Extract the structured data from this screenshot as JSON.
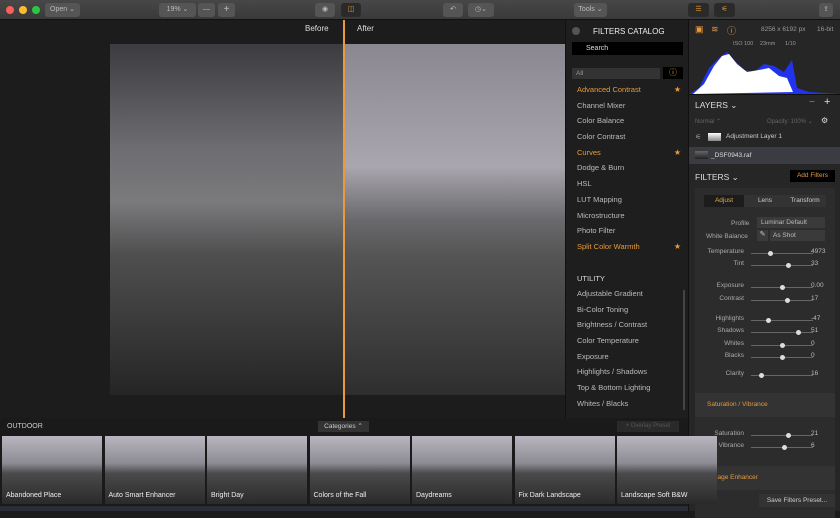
{
  "toolbar": {
    "open": "Open ⌄",
    "zoom": "19%  ⌄",
    "zoom_out": "—",
    "zoom_in": "+",
    "tools": "Tools ⌄"
  },
  "viewer": {
    "before": "Before",
    "after": "After"
  },
  "catalog": {
    "title": "FILTERS CATALOG",
    "search_placeholder": "Search",
    "filter": "All",
    "items": [
      {
        "label": "Advanced Contrast",
        "fav": true
      },
      {
        "label": "Channel Mixer"
      },
      {
        "label": "Color Balance"
      },
      {
        "label": "Color Contrast"
      },
      {
        "label": "Curves",
        "fav": true
      },
      {
        "label": "Dodge & Burn"
      },
      {
        "label": "HSL"
      },
      {
        "label": "LUT Mapping"
      },
      {
        "label": "Microstructure"
      },
      {
        "label": "Photo Filter"
      },
      {
        "label": "Split Color Warmth",
        "fav": true
      }
    ],
    "utility_header": "UTILITY",
    "utility": [
      "Adjustable Gradient",
      "Bi-Color Toning",
      "Brightness / Contrast",
      "Color Temperature",
      "Exposure",
      "Highlights / Shadows",
      "Top & Bottom Lighting",
      "Whites / Blacks"
    ]
  },
  "info": {
    "dimensions": "8256 x 6192 px",
    "bitdepth": "16-bit",
    "iso": "ISO 100",
    "focal": "23mm",
    "shutter": "1/10"
  },
  "layers": {
    "title": "LAYERS ⌄",
    "blend": "Normal ⌃",
    "opacity": "Opacity: 100% ⌄",
    "items": [
      "Adjustment Layer 1",
      "_DSF0943.raf"
    ]
  },
  "filters": {
    "title": "FILTERS ⌄",
    "add": "Add Filters",
    "tabs": [
      "Adjust",
      "Lens",
      "Transform"
    ],
    "profile_label": "Profile",
    "profile": "Luminar Default",
    "wb_label": "White Balance",
    "wb": "As Shot",
    "sliders": [
      {
        "label": "Temperature",
        "value": "4973",
        "pos": 0.3
      },
      {
        "label": "Tint",
        "value": "33",
        "pos": 0.6
      },
      {
        "label": "Exposure",
        "value": "0.00",
        "pos": 0.5
      },
      {
        "label": "Contrast",
        "value": "17",
        "pos": 0.58
      },
      {
        "label": "Highlights",
        "value": "-47",
        "pos": 0.27
      },
      {
        "label": "Shadows",
        "value": "51",
        "pos": 0.75
      },
      {
        "label": "Whites",
        "value": "0",
        "pos": 0.5
      },
      {
        "label": "Blacks",
        "value": "0",
        "pos": 0.5
      },
      {
        "label": "Clarity",
        "value": "16",
        "pos": 0.16
      }
    ],
    "sat_title": "Saturation / Vibrance",
    "sat_sliders": [
      {
        "label": "Saturation",
        "value": "21",
        "pos": 0.6
      },
      {
        "label": "Vibrance",
        "value": "6",
        "pos": 0.53
      }
    ],
    "foliage_title": "Foliage Enhancer",
    "save": "Save Filters Preset..."
  },
  "presets": {
    "category": "OUTDOOR",
    "categories": "Categories ⌃",
    "overlay": "+ Overlay Preset",
    "items": [
      "Abandoned Place",
      "Auto Smart Enhancer",
      "Bright Day",
      "Colors of the Fall",
      "Daydreams",
      "Fix Dark Landscape",
      "Landscape Soft B&W"
    ]
  },
  "colors": {
    "accent": "#e89a3c"
  }
}
